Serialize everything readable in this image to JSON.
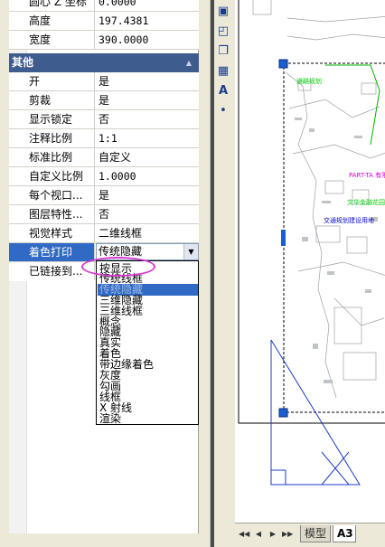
{
  "properties": {
    "top_rows": [
      {
        "name": "圆心 Z 坐标",
        "value": "0.0000"
      },
      {
        "name": "高度",
        "value": "197.4381"
      },
      {
        "name": "宽度",
        "value": "390.0000"
      }
    ],
    "section_title": "其他",
    "rows": [
      {
        "name": "开",
        "value": "是"
      },
      {
        "name": "剪裁",
        "value": "是"
      },
      {
        "name": "显示锁定",
        "value": "否"
      },
      {
        "name": "注释比例",
        "value": "1:1"
      },
      {
        "name": "标准比例",
        "value": "自定义"
      },
      {
        "name": "自定义比例",
        "value": "1.0000"
      },
      {
        "name": "每个视口...",
        "value": "是"
      },
      {
        "name": "图层特性...",
        "value": "否"
      },
      {
        "name": "视觉样式",
        "value": "二维线框"
      }
    ],
    "selected_row": {
      "name": "着色打印",
      "value": "传统隐藏"
    },
    "last_row": {
      "name": "已链接到..."
    }
  },
  "dropdown": {
    "options": [
      "按显示",
      "传统线框",
      "传统隐藏",
      "三维隐藏",
      "三维线框",
      "概念",
      "隐藏",
      "真实",
      "着色",
      "带边缘着色",
      "灰度",
      "勾画",
      "线框",
      "X 射线",
      "渲染"
    ],
    "highlighted_index": 2
  },
  "layout_tabs": {
    "model": "模型",
    "active": "A3"
  },
  "drawing_labels": [
    {
      "text": "道路规划",
      "color": "#00cc00"
    },
    {
      "text": "PART-TA 有限公司",
      "color": "#cc00cc"
    },
    {
      "text": "文华金融花园",
      "color": "#00cc00"
    },
    {
      "text": "交通规划建设用地",
      "color": "#0000cc"
    }
  ],
  "colors": {
    "accent": "#316ac5",
    "section_header": "#3f5c8e",
    "highlight_ellipse": "#d83ad0",
    "viewport_lines": "#1a3cc8"
  }
}
